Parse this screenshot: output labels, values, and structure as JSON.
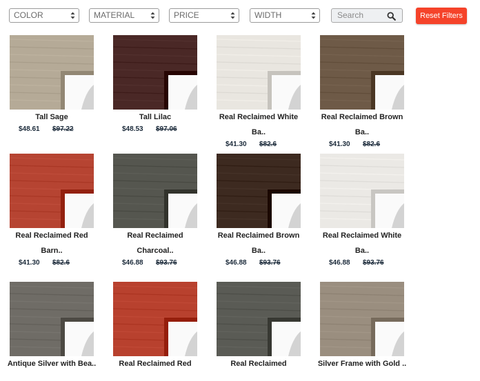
{
  "filters": {
    "color": "COLOR",
    "material": "MATERIAL",
    "price": "PRICE",
    "width": "WIDTH",
    "search_placeholder": "Search",
    "reset_label": "Reset Filters"
  },
  "colors": {
    "reset_button": "#f5432a",
    "text": "#1b2a3a"
  },
  "products": [
    {
      "name_line1": "Tall Sage",
      "name_line2": "",
      "price": "$48.61",
      "original_price": "$97.22",
      "frame_color": "#b5aa97"
    },
    {
      "name_line1": "Tall Lilac",
      "name_line2": "",
      "price": "$48.53",
      "original_price": "$97.06",
      "frame_color": "#4a2826"
    },
    {
      "name_line1": "Real Reclaimed White",
      "name_line2": "Ba..",
      "price": "$41.30",
      "original_price": "$82.6",
      "frame_color": "#e9e6e0"
    },
    {
      "name_line1": "Real Reclaimed Brown",
      "name_line2": "Ba..",
      "price": "$41.30",
      "original_price": "$82.6",
      "frame_color": "#6e5a47"
    },
    {
      "name_line1": "Real Reclaimed Red",
      "name_line2": "Barn..",
      "price": "$41.30",
      "original_price": "$82.6",
      "frame_color": "#b64432"
    },
    {
      "name_line1": "Real Reclaimed",
      "name_line2": "Charcoal..",
      "price": "$46.88",
      "original_price": "$93.76",
      "frame_color": "#55564f"
    },
    {
      "name_line1": "Real Reclaimed Brown",
      "name_line2": "Ba..",
      "price": "$46.88",
      "original_price": "$93.76",
      "frame_color": "#3d2a20"
    },
    {
      "name_line1": "Real Reclaimed White",
      "name_line2": "Ba..",
      "price": "$46.88",
      "original_price": "$93.76",
      "frame_color": "#ebe9e5"
    },
    {
      "name_line1": "Antique Silver with Bea..",
      "name_line2": "",
      "price": "",
      "original_price": "",
      "frame_color": "#6f6c66"
    },
    {
      "name_line1": "Real Reclaimed Red",
      "name_line2": "",
      "price": "",
      "original_price": "",
      "frame_color": "#b8412e"
    },
    {
      "name_line1": "Real Reclaimed",
      "name_line2": "",
      "price": "",
      "original_price": "",
      "frame_color": "#5a5b55"
    },
    {
      "name_line1": "Silver Frame with Gold ..",
      "name_line2": "",
      "price": "",
      "original_price": "",
      "frame_color": "#9a8e7f"
    }
  ]
}
